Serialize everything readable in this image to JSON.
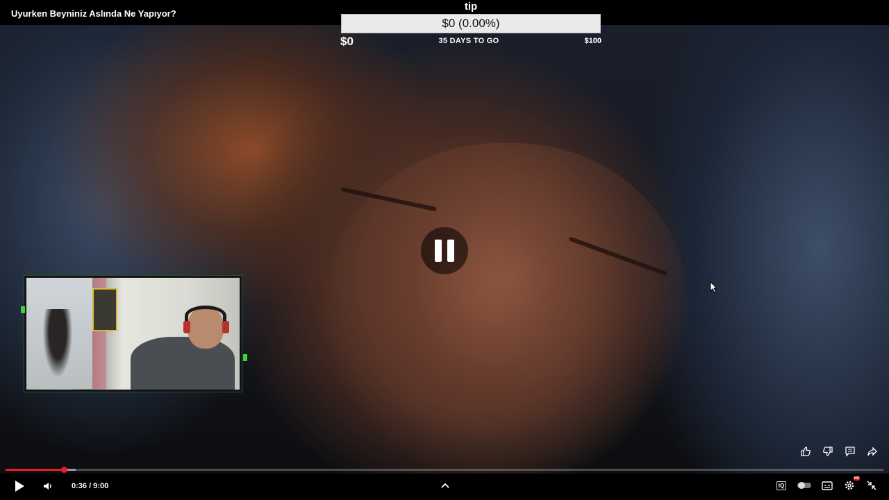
{
  "video": {
    "title": "Uyurken Beyniniz Aslında Ne Yapıyor?"
  },
  "tip_widget": {
    "label": "tip",
    "amount_display": "$0 (0.00%)",
    "min_label": "$0",
    "days_label": "35 DAYS TO GO",
    "goal_label": "$100"
  },
  "player": {
    "state": "paused",
    "center_icon": "pause-icon",
    "time_display": "0:36 / 9:00",
    "progress_fraction": 0.0667,
    "buffer_fraction": 0.08,
    "accent_color": "#e31d2b"
  },
  "action_icons": [
    "thumbs-up-icon",
    "thumbs-down-icon",
    "comment-icon",
    "share-icon"
  ],
  "controls": {
    "left": [
      "play-icon",
      "volume-icon"
    ],
    "center": [
      "chevron-up-icon"
    ],
    "right": [
      "iq-icon",
      "autoplay-toggle-icon",
      "subtitles-icon",
      "settings-icon",
      "exit-fullscreen-icon"
    ],
    "iq_label": "IQ",
    "settings_badge": "HD"
  }
}
